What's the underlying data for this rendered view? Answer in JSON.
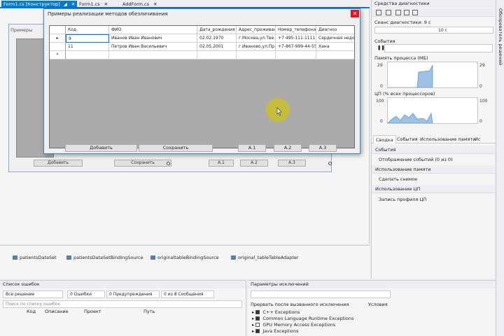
{
  "doc_tabs": [
    {
      "label": "Form1.cs [Конструктор]",
      "close": "✕",
      "pin": "◢"
    },
    {
      "label": "Form1.cs",
      "close": "✕"
    },
    {
      "label": "AddForm.cs",
      "close": "✕"
    }
  ],
  "designer_bg_form": {
    "title": "Примеры",
    "buttons": [
      "Добавить",
      "Сохранить",
      "A.1",
      "A.2",
      "A.3"
    ]
  },
  "window": {
    "title": "Примеры реализации методов обезличивания",
    "close": "✕",
    "columns": [
      "Код",
      "ФИО",
      "Дата_рождения",
      "Адрес_проживания",
      "Номер_телефона",
      "Диагноз"
    ],
    "rows": [
      {
        "marker": "▸",
        "cells": [
          "9",
          "Иванов Иван Иванович",
          "02.02.1970",
          "г.Москва,ул.Тве...",
          "+7 495-111-1111",
          "Сердечная недо..."
        ]
      },
      {
        "marker": "",
        "cells": [
          "11",
          "Петров Иван Васильевич",
          "02.05.2001",
          "г.Иваново,ул.Пр...",
          "+7-867-999-44-55",
          "Хана"
        ]
      },
      {
        "marker": "*",
        "cells": [
          "",
          "",
          "",
          "",
          "",
          ""
        ]
      }
    ],
    "buttons": {
      "add": "Добавить",
      "save": "Сохранить",
      "a1": "A.1",
      "a2": "A.2",
      "a3": "A.3"
    }
  },
  "tray": [
    "patientsDataSet",
    "patientsDataSetBindingSource",
    "originaltableBindingSource",
    "original_tableTableAdapter"
  ],
  "diagnostics": {
    "title": "Средства диагностики",
    "session": "Сеанс диагностики: 9 с",
    "timeline_tick": "10 с",
    "events_label": "События",
    "memory_label": "Память процесса (МБ)",
    "memory_max": "29",
    "memory_min": "0",
    "cpu_label": "ЦП (% всех процессоров)",
    "cpu_max": "100",
    "cpu_min": "0",
    "tabs": [
      "Сводка",
      "События",
      "Использование памяти",
      "Ис"
    ],
    "sections": {
      "events": {
        "header": "События",
        "item": "Отображение событий (0 из 0)"
      },
      "memory": {
        "header": "Использование памяти",
        "item": "Сделать снимок"
      },
      "cpu": {
        "header": "Использование ЦП",
        "item": "Запись профиля ЦП"
      }
    }
  },
  "vertical_tab": "Обозреватель решений",
  "error_list": {
    "title": "Список ошибок",
    "scope": "Все решение",
    "errors": "0 Ошибки",
    "warnings": "0 Предупреждения",
    "messages": "0 из 8 Сообщения",
    "search_placeholder": "Поиск по списку ошибок",
    "columns": [
      "Код",
      "Описание",
      "Проект",
      "Путь"
    ]
  },
  "exception_settings": {
    "title": "Параметры исключений",
    "col_break": "Прервать после вызванного исключения",
    "col_conditions": "Условия",
    "items": [
      {
        "label": "C++ Exceptions",
        "checked": true
      },
      {
        "label": "Common Language Runtime Exceptions",
        "checked": true
      },
      {
        "label": "GPU Memory Access Exceptions",
        "checked": false
      },
      {
        "label": "Java Exceptions",
        "checked": true
      }
    ]
  }
}
